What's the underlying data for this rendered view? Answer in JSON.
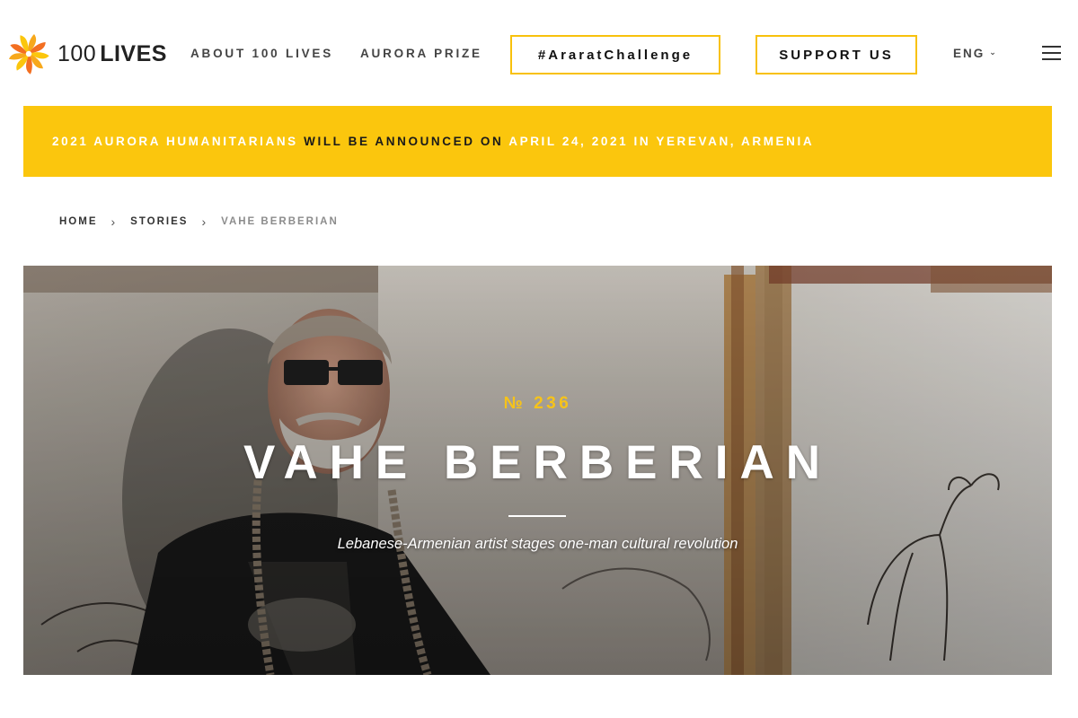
{
  "brand": {
    "logo_number": "100",
    "logo_word": "LIVES",
    "accent_color": "#fbc60d",
    "logo_colors": [
      "#f7a81b",
      "#f36f21",
      "#fbc60d"
    ]
  },
  "nav": {
    "about": "ABOUT 100 LIVES",
    "prize": "AURORA PRIZE",
    "challenge": "#AraratChallenge",
    "support": "SUPPORT US",
    "language": "ENG",
    "language_chevron": "⌄",
    "menu_icon": "hamburger-menu-icon"
  },
  "banner": {
    "part1": "2021 AURORA HUMANITARIANS ",
    "part2": "WILL BE ANNOUNCED ON ",
    "part3": "APRIL 24, 2021 IN YEREVAN, ARMENIA"
  },
  "breadcrumb": {
    "items": [
      "HOME",
      "STORIES",
      "VAHE BERBERIAN"
    ],
    "separator": "›"
  },
  "hero": {
    "number": "№ 236",
    "title": "VAHE BERBERIAN",
    "subtitle": "Lebanese-Armenian artist stages one-man cultural revolution",
    "image": "portrait of a bearded man with glasses and long braids in front of painted canvases"
  }
}
